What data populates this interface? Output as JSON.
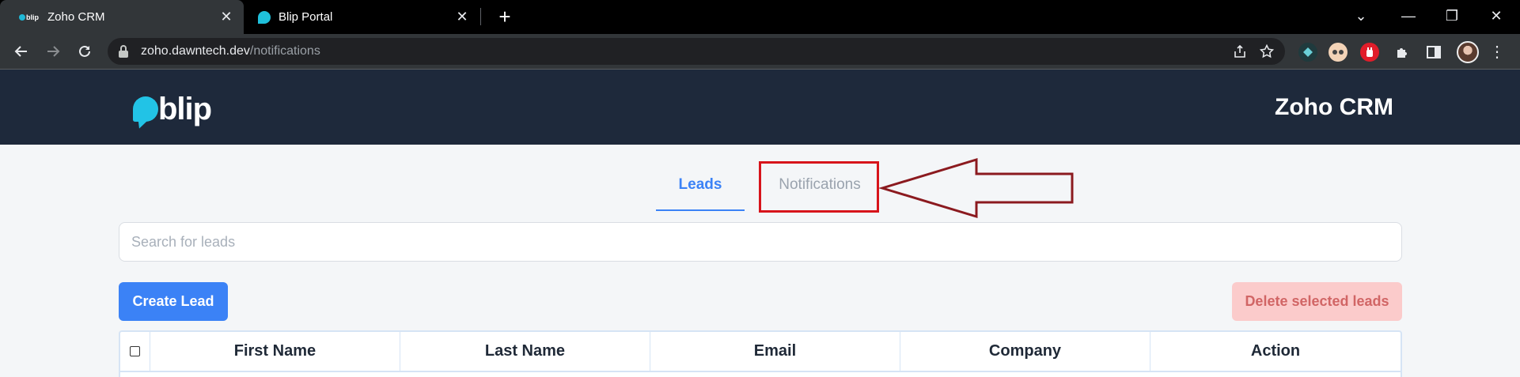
{
  "browser": {
    "tabs": [
      {
        "title": "Zoho CRM",
        "active": true,
        "favicon": "blip-logo-icon"
      },
      {
        "title": "Blip Portal",
        "active": false,
        "favicon": "blip-bubble-icon"
      }
    ],
    "favicon_text": "blip",
    "close_glyph": "✕",
    "new_tab_glyph": "+",
    "window_controls": [
      "⌄",
      "—",
      "❐",
      "✕"
    ],
    "url_host": "zoho.dawntech.dev",
    "url_path": "/notifications",
    "extension_colors": [
      "#1f3a3d",
      "#f3d3b7",
      "#e11d2a"
    ]
  },
  "app": {
    "logo_text": "blip",
    "title": "Zoho CRM",
    "brand_color": "#22c3e6",
    "header_color": "#1e293b"
  },
  "nav": {
    "tabs": [
      {
        "label": "Leads",
        "active": true
      },
      {
        "label": "Notifications",
        "active": false
      }
    ],
    "accent": "#3b82f6"
  },
  "annotation": {
    "highlight_color": "#d7141b",
    "arrow_color": "#8b1a1f"
  },
  "search": {
    "placeholder": "Search for leads",
    "value": ""
  },
  "actions": {
    "create_label": "Create Lead",
    "delete_label": "Delete selected leads"
  },
  "table": {
    "columns": [
      "First Name",
      "Last Name",
      "Email",
      "Company",
      "Action"
    ],
    "select_all_checked": false
  }
}
